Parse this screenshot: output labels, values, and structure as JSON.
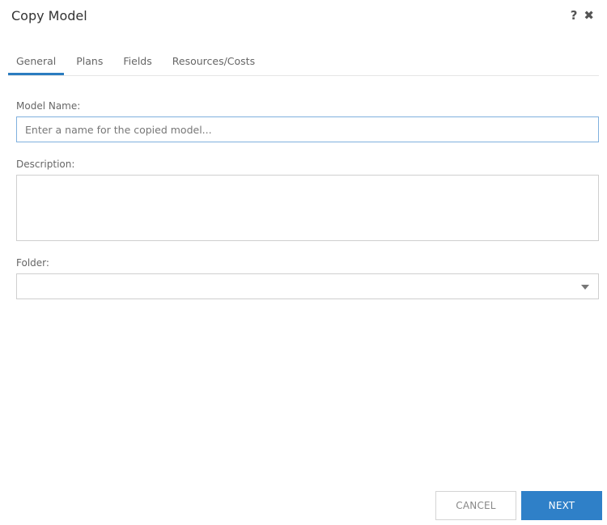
{
  "dialog": {
    "title": "Copy Model",
    "help_icon": "?",
    "close_icon": "✖"
  },
  "tabs": [
    {
      "label": "General",
      "active": true
    },
    {
      "label": "Plans",
      "active": false
    },
    {
      "label": "Fields",
      "active": false
    },
    {
      "label": "Resources/Costs",
      "active": false
    }
  ],
  "form": {
    "model_name": {
      "label": "Model Name:",
      "value": "",
      "placeholder": "Enter a name for the copied model..."
    },
    "description": {
      "label": "Description:",
      "value": ""
    },
    "folder": {
      "label": "Folder:",
      "selected": ""
    }
  },
  "footer": {
    "cancel_label": "CANCEL",
    "next_label": "NEXT"
  },
  "colors": {
    "accent": "#2f80c8",
    "active_tab_underline": "#2b7cc0",
    "focused_input_border": "#7fb0de"
  }
}
